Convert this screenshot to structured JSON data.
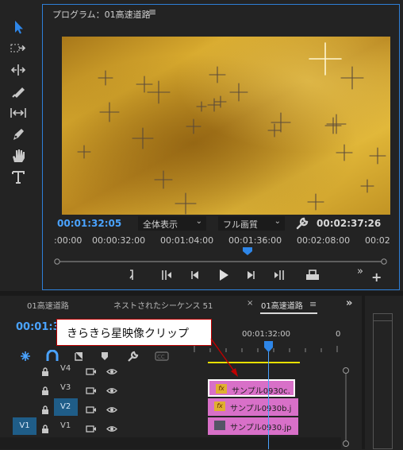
{
  "toolbar": {
    "tools": [
      "selection-tool",
      "track-select-tool",
      "ripple-edit-tool",
      "razor-tool",
      "slip-tool",
      "pen-tool",
      "hand-tool",
      "type-tool"
    ]
  },
  "program_monitor": {
    "title": "プログラム：01高速道路",
    "menu_icon": "≡",
    "current_timecode": "00:01:32:05",
    "zoom_select": "全体表示",
    "quality_select": "フル画質",
    "duration_timecode": "00:02:37:26",
    "ruler_labels": [
      ":00:00",
      "00:00:32:00",
      "00:01:04:00",
      "00:01:36:00",
      "00:02:08:00",
      "00:02"
    ],
    "more_icon": "»",
    "add_icon": "+"
  },
  "timeline": {
    "tabs": [
      "01高速道路",
      "ネストされたシーケンス 51",
      "01高速道路"
    ],
    "tab_close": "×",
    "tab_menu": "≡",
    "chevrons": "»",
    "current_timecode": "00:01:3",
    "ruler_timecode": "00:01:32:00",
    "ruler_timecode_2": "0",
    "tracks": [
      {
        "name": "V4",
        "clip": null
      },
      {
        "name": "V3",
        "clip": "サンプル0930c."
      },
      {
        "name": "V2",
        "clip": "サンプル0930b.j"
      },
      {
        "name": "V1",
        "clip": "サンプル0930.jp",
        "source": "V1"
      }
    ],
    "fx_label": "fx"
  },
  "callout": {
    "text": "きらきら星映像クリップ"
  },
  "colors": {
    "accent": "#2e7fd8",
    "timecode": "#4aa3ff",
    "clip": "#d870c8",
    "gold": "#c89a1e"
  }
}
